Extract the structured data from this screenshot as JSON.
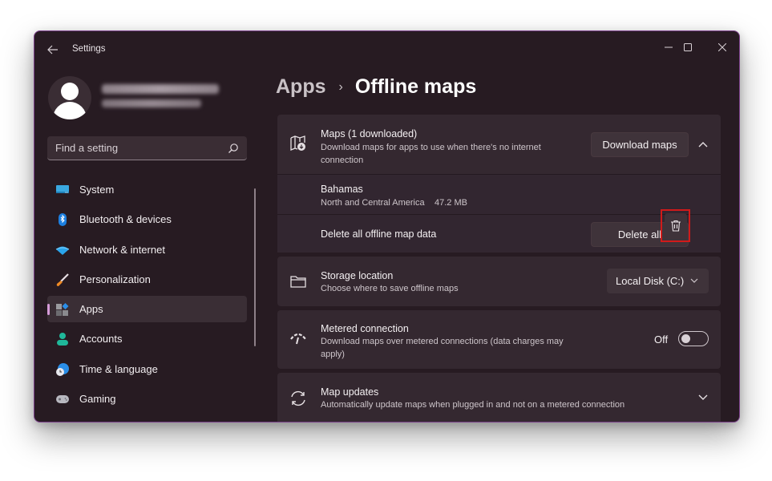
{
  "window": {
    "title": "Settings",
    "controls": {
      "minimize": "minimize",
      "maximize": "maximize",
      "close": "close"
    }
  },
  "profile": {
    "name": "[redacted name]",
    "email": "[redacted email]"
  },
  "search": {
    "placeholder": "Find a setting",
    "value": ""
  },
  "sidebar": {
    "items": [
      {
        "label": "System",
        "icon": "monitor-icon",
        "active": false
      },
      {
        "label": "Bluetooth & devices",
        "icon": "bluetooth-icon",
        "active": false
      },
      {
        "label": "Network & internet",
        "icon": "wifi-icon",
        "active": false
      },
      {
        "label": "Personalization",
        "icon": "paintbrush-icon",
        "active": false
      },
      {
        "label": "Apps",
        "icon": "apps-icon",
        "active": true
      },
      {
        "label": "Accounts",
        "icon": "person-icon",
        "active": false
      },
      {
        "label": "Time & language",
        "icon": "clock-globe-icon",
        "active": false
      },
      {
        "label": "Gaming",
        "icon": "gamepad-icon",
        "active": false
      }
    ]
  },
  "breadcrumb": {
    "parent": "Apps",
    "separator": "›",
    "current": "Offline maps"
  },
  "maps_card": {
    "title": "Maps (1 downloaded)",
    "description": "Download maps for apps to use when there's no internet connection",
    "download_button": "Download maps",
    "expanded": true,
    "downloaded": [
      {
        "name": "Bahamas",
        "region": "North and Central America",
        "size": "47.2 MB"
      }
    ],
    "delete_all_label": "Delete all offline map data",
    "delete_all_button": "Delete all"
  },
  "storage": {
    "title": "Storage location",
    "description": "Choose where to save offline maps",
    "selected": "Local Disk (C:)"
  },
  "metered": {
    "title": "Metered connection",
    "description": "Download maps over metered connections (data charges may apply)",
    "state_label": "Off",
    "enabled": false
  },
  "updates": {
    "title": "Map updates",
    "description": "Automatically update maps when plugged in and not on a metered connection"
  },
  "colors": {
    "window_bg": "#271b22",
    "card_bg": "#342830",
    "accent": "#d69bd8",
    "highlight": "#d11a1a"
  }
}
